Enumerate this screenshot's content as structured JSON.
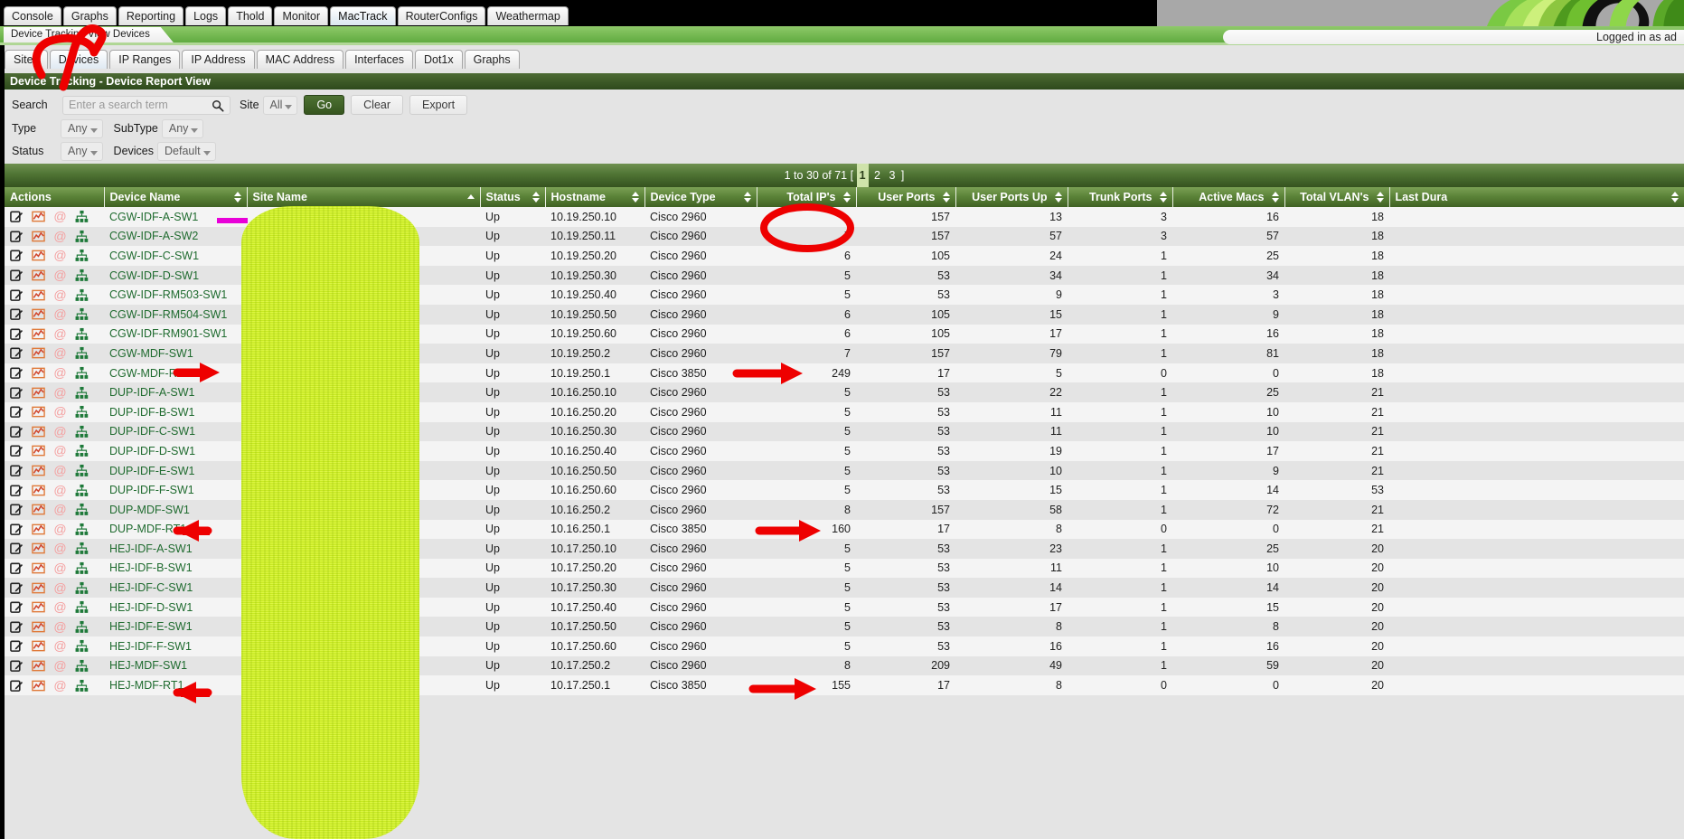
{
  "app": {
    "title": "Device Tracking - Device Report View",
    "logged_in_text": "Logged in as ad"
  },
  "menu_tabs": [
    {
      "label": "Console",
      "active": false
    },
    {
      "label": "Graphs",
      "active": false
    },
    {
      "label": "Reporting",
      "active": false
    },
    {
      "label": "Logs",
      "active": false
    },
    {
      "label": "Thold",
      "active": false
    },
    {
      "label": "Monitor",
      "active": false
    },
    {
      "label": "MacTrack",
      "active": true
    },
    {
      "label": "RouterConfigs",
      "active": false
    },
    {
      "label": "Weathermap",
      "active": false
    }
  ],
  "breadcrumb": "Device Tracking View Devices",
  "sub_tabs": [
    {
      "label": "Sites",
      "active": false
    },
    {
      "label": "Devices",
      "active": true
    },
    {
      "label": "IP Ranges",
      "active": false
    },
    {
      "label": "IP Address",
      "active": false
    },
    {
      "label": "MAC Address",
      "active": false
    },
    {
      "label": "Interfaces",
      "active": false
    },
    {
      "label": "Dot1x",
      "active": false
    },
    {
      "label": "Graphs",
      "active": false
    }
  ],
  "filters": {
    "search_label": "Search",
    "search_value": "",
    "search_placeholder": "Enter a search term",
    "site_label": "Site",
    "site_value": "All",
    "go_label": "Go",
    "clear_label": "Clear",
    "export_label": "Export",
    "type_label": "Type",
    "type_value": "Any",
    "subtype_label": "SubType",
    "subtype_value": "Any",
    "status_label": "Status",
    "status_value": "Any",
    "devices_label": "Devices",
    "devices_value": "Default"
  },
  "pagination": {
    "range_text": "1 to 30 of 71",
    "open_bracket": "[",
    "close_bracket": "]",
    "pages": [
      "1",
      "2",
      "3"
    ],
    "current_page": "1"
  },
  "table": {
    "columns": [
      {
        "label": "Actions",
        "sortable": false,
        "align": "left"
      },
      {
        "label": "Device Name",
        "sortable": true,
        "align": "left"
      },
      {
        "label": "Site Name",
        "sortable": true,
        "sorted": "asc",
        "align": "left"
      },
      {
        "label": "Status",
        "sortable": true,
        "align": "left"
      },
      {
        "label": "Hostname",
        "sortable": true,
        "align": "left"
      },
      {
        "label": "Device Type",
        "sortable": true,
        "align": "left"
      },
      {
        "label": "Total IP's",
        "sortable": true,
        "align": "right"
      },
      {
        "label": "User Ports",
        "sortable": true,
        "align": "right"
      },
      {
        "label": "User Ports Up",
        "sortable": true,
        "align": "right"
      },
      {
        "label": "Trunk Ports",
        "sortable": true,
        "align": "right"
      },
      {
        "label": "Active Macs",
        "sortable": true,
        "align": "right"
      },
      {
        "label": "Total VLAN's",
        "sortable": true,
        "align": "right"
      },
      {
        "label": "Last Dura",
        "sortable": true,
        "align": "left"
      }
    ],
    "action_icons": [
      "edit-icon",
      "graph-icon",
      "at-icon",
      "tree-icon"
    ],
    "rows": [
      {
        "device_name": "CGW-IDF-A-SW1",
        "site_name": "",
        "status": "Up",
        "hostname": "10.19.250.10",
        "device_type": "Cisco 2960",
        "total_ips": "",
        "user_ports": "157",
        "user_ports_up": "13",
        "trunk_ports": "3",
        "active_macs": "16",
        "total_vlans": "18",
        "last_duration": ""
      },
      {
        "device_name": "CGW-IDF-A-SW2",
        "site_name": "",
        "status": "Up",
        "hostname": "10.19.250.11",
        "device_type": "Cisco 2960",
        "total_ips": "7",
        "user_ports": "157",
        "user_ports_up": "57",
        "trunk_ports": "3",
        "active_macs": "57",
        "total_vlans": "18",
        "last_duration": ""
      },
      {
        "device_name": "CGW-IDF-C-SW1",
        "site_name": "",
        "status": "Up",
        "hostname": "10.19.250.20",
        "device_type": "Cisco 2960",
        "total_ips": "6",
        "user_ports": "105",
        "user_ports_up": "24",
        "trunk_ports": "1",
        "active_macs": "25",
        "total_vlans": "18",
        "last_duration": ""
      },
      {
        "device_name": "CGW-IDF-D-SW1",
        "site_name": "",
        "status": "Up",
        "hostname": "10.19.250.30",
        "device_type": "Cisco 2960",
        "total_ips": "5",
        "user_ports": "53",
        "user_ports_up": "34",
        "trunk_ports": "1",
        "active_macs": "34",
        "total_vlans": "18",
        "last_duration": ""
      },
      {
        "device_name": "CGW-IDF-RM503-SW1",
        "site_name": "",
        "status": "Up",
        "hostname": "10.19.250.40",
        "device_type": "Cisco 2960",
        "total_ips": "5",
        "user_ports": "53",
        "user_ports_up": "9",
        "trunk_ports": "1",
        "active_macs": "3",
        "total_vlans": "18",
        "last_duration": ""
      },
      {
        "device_name": "CGW-IDF-RM504-SW1",
        "site_name": "",
        "status": "Up",
        "hostname": "10.19.250.50",
        "device_type": "Cisco 2960",
        "total_ips": "6",
        "user_ports": "105",
        "user_ports_up": "15",
        "trunk_ports": "1",
        "active_macs": "9",
        "total_vlans": "18",
        "last_duration": ""
      },
      {
        "device_name": "CGW-IDF-RM901-SW1",
        "site_name": "",
        "status": "Up",
        "hostname": "10.19.250.60",
        "device_type": "Cisco 2960",
        "total_ips": "6",
        "user_ports": "105",
        "user_ports_up": "17",
        "trunk_ports": "1",
        "active_macs": "16",
        "total_vlans": "18",
        "last_duration": ""
      },
      {
        "device_name": "CGW-MDF-SW1",
        "site_name": "",
        "status": "Up",
        "hostname": "10.19.250.2",
        "device_type": "Cisco 2960",
        "total_ips": "7",
        "user_ports": "157",
        "user_ports_up": "79",
        "trunk_ports": "1",
        "active_macs": "81",
        "total_vlans": "18",
        "last_duration": ""
      },
      {
        "device_name": "CGW-MDF-RT1",
        "site_name": "",
        "status": "Up",
        "hostname": "10.19.250.1",
        "device_type": "Cisco 3850",
        "total_ips": "249",
        "user_ports": "17",
        "user_ports_up": "5",
        "trunk_ports": "0",
        "active_macs": "0",
        "total_vlans": "18",
        "last_duration": ""
      },
      {
        "device_name": "DUP-IDF-A-SW1",
        "site_name": "",
        "status": "Up",
        "hostname": "10.16.250.10",
        "device_type": "Cisco 2960",
        "total_ips": "5",
        "user_ports": "53",
        "user_ports_up": "22",
        "trunk_ports": "1",
        "active_macs": "25",
        "total_vlans": "21",
        "last_duration": ""
      },
      {
        "device_name": "DUP-IDF-B-SW1",
        "site_name": "",
        "status": "Up",
        "hostname": "10.16.250.20",
        "device_type": "Cisco 2960",
        "total_ips": "5",
        "user_ports": "53",
        "user_ports_up": "11",
        "trunk_ports": "1",
        "active_macs": "10",
        "total_vlans": "21",
        "last_duration": ""
      },
      {
        "device_name": "DUP-IDF-C-SW1",
        "site_name": "",
        "status": "Up",
        "hostname": "10.16.250.30",
        "device_type": "Cisco 2960",
        "total_ips": "5",
        "user_ports": "53",
        "user_ports_up": "11",
        "trunk_ports": "1",
        "active_macs": "10",
        "total_vlans": "21",
        "last_duration": ""
      },
      {
        "device_name": "DUP-IDF-D-SW1",
        "site_name": "",
        "status": "Up",
        "hostname": "10.16.250.40",
        "device_type": "Cisco 2960",
        "total_ips": "5",
        "user_ports": "53",
        "user_ports_up": "19",
        "trunk_ports": "1",
        "active_macs": "17",
        "total_vlans": "21",
        "last_duration": ""
      },
      {
        "device_name": "DUP-IDF-E-SW1",
        "site_name": "",
        "status": "Up",
        "hostname": "10.16.250.50",
        "device_type": "Cisco 2960",
        "total_ips": "5",
        "user_ports": "53",
        "user_ports_up": "10",
        "trunk_ports": "1",
        "active_macs": "9",
        "total_vlans": "21",
        "last_duration": ""
      },
      {
        "device_name": "DUP-IDF-F-SW1",
        "site_name": "",
        "status": "Up",
        "hostname": "10.16.250.60",
        "device_type": "Cisco 2960",
        "total_ips": "5",
        "user_ports": "53",
        "user_ports_up": "15",
        "trunk_ports": "1",
        "active_macs": "14",
        "total_vlans": "53",
        "last_duration": ""
      },
      {
        "device_name": "DUP-MDF-SW1",
        "site_name": "",
        "status": "Up",
        "hostname": "10.16.250.2",
        "device_type": "Cisco 2960",
        "total_ips": "8",
        "user_ports": "157",
        "user_ports_up": "58",
        "trunk_ports": "1",
        "active_macs": "72",
        "total_vlans": "21",
        "last_duration": ""
      },
      {
        "device_name": "DUP-MDF-RT1",
        "site_name": "",
        "status": "Up",
        "hostname": "10.16.250.1",
        "device_type": "Cisco 3850",
        "total_ips": "160",
        "user_ports": "17",
        "user_ports_up": "8",
        "trunk_ports": "0",
        "active_macs": "0",
        "total_vlans": "21",
        "last_duration": ""
      },
      {
        "device_name": "HEJ-IDF-A-SW1",
        "site_name": "",
        "status": "Up",
        "hostname": "10.17.250.10",
        "device_type": "Cisco 2960",
        "total_ips": "5",
        "user_ports": "53",
        "user_ports_up": "23",
        "trunk_ports": "1",
        "active_macs": "25",
        "total_vlans": "20",
        "last_duration": ""
      },
      {
        "device_name": "HEJ-IDF-B-SW1",
        "site_name": "",
        "status": "Up",
        "hostname": "10.17.250.20",
        "device_type": "Cisco 2960",
        "total_ips": "5",
        "user_ports": "53",
        "user_ports_up": "11",
        "trunk_ports": "1",
        "active_macs": "10",
        "total_vlans": "20",
        "last_duration": ""
      },
      {
        "device_name": "HEJ-IDF-C-SW1",
        "site_name": "",
        "status": "Up",
        "hostname": "10.17.250.30",
        "device_type": "Cisco 2960",
        "total_ips": "5",
        "user_ports": "53",
        "user_ports_up": "14",
        "trunk_ports": "1",
        "active_macs": "14",
        "total_vlans": "20",
        "last_duration": ""
      },
      {
        "device_name": "HEJ-IDF-D-SW1",
        "site_name": "",
        "status": "Up",
        "hostname": "10.17.250.40",
        "device_type": "Cisco 2960",
        "total_ips": "5",
        "user_ports": "53",
        "user_ports_up": "17",
        "trunk_ports": "1",
        "active_macs": "15",
        "total_vlans": "20",
        "last_duration": ""
      },
      {
        "device_name": "HEJ-IDF-E-SW1",
        "site_name": "",
        "status": "Up",
        "hostname": "10.17.250.50",
        "device_type": "Cisco 2960",
        "total_ips": "5",
        "user_ports": "53",
        "user_ports_up": "8",
        "trunk_ports": "1",
        "active_macs": "8",
        "total_vlans": "20",
        "last_duration": ""
      },
      {
        "device_name": "HEJ-IDF-F-SW1",
        "site_name": "",
        "status": "Up",
        "hostname": "10.17.250.60",
        "device_type": "Cisco 2960",
        "total_ips": "5",
        "user_ports": "53",
        "user_ports_up": "16",
        "trunk_ports": "1",
        "active_macs": "16",
        "total_vlans": "20",
        "last_duration": ""
      },
      {
        "device_name": "HEJ-MDF-SW1",
        "site_name": "",
        "status": "Up",
        "hostname": "10.17.250.2",
        "device_type": "Cisco 2960",
        "total_ips": "8",
        "user_ports": "209",
        "user_ports_up": "49",
        "trunk_ports": "1",
        "active_macs": "59",
        "total_vlans": "20",
        "last_duration": ""
      },
      {
        "device_name": "HEJ-MDF-RT1",
        "site_name": "",
        "status": "Up",
        "hostname": "10.17.250.1",
        "device_type": "Cisco 3850",
        "total_ips": "155",
        "user_ports": "17",
        "user_ports_up": "8",
        "trunk_ports": "0",
        "active_macs": "0",
        "total_vlans": "20",
        "last_duration": ""
      }
    ]
  },
  "annotations": {
    "colors": {
      "highlight_red": "#ee0000",
      "redaction_yellow": "#d4f224",
      "magenta_mark": "#e800d8"
    },
    "circled_items": [
      "Devices sub-tab",
      "Total IP's column header"
    ],
    "arrow_targets": [
      "CGW-MDF-RT1",
      "249",
      "DUP-MDF-RT1",
      "160",
      "HEJ-MDF-RT1",
      "155"
    ]
  }
}
